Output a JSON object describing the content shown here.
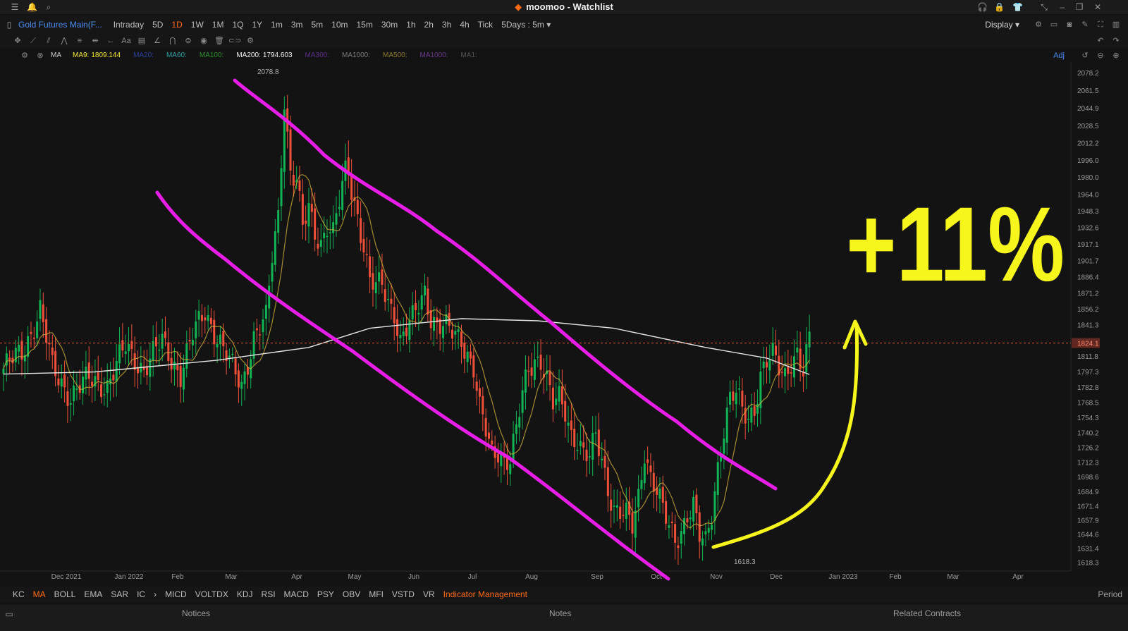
{
  "window": {
    "title": "moomoo - Watchlist"
  },
  "header": {
    "symbol": "Gold Futures Main(F...",
    "timeframes": [
      "Intraday",
      "5D",
      "1D",
      "1W",
      "1M",
      "1Q",
      "1Y",
      "1m",
      "3m",
      "5m",
      "10m",
      "15m",
      "30m",
      "1h",
      "2h",
      "3h",
      "4h",
      "Tick",
      "5Days : 5m"
    ],
    "active_timeframe_index": 2,
    "display_label": "Display"
  },
  "ma_bar": {
    "label": "MA",
    "items": [
      {
        "label": "MA9:",
        "value": "1809.144",
        "color": "#f2e630"
      },
      {
        "label": "MA20:",
        "value": "",
        "color": "#2d3f9e"
      },
      {
        "label": "MA60:",
        "value": "",
        "color": "#2aa1a1"
      },
      {
        "label": "MA100:",
        "value": "",
        "color": "#2f8f2f"
      },
      {
        "label": "MA200:",
        "value": "1794.603",
        "color": "#f0f0f0"
      },
      {
        "label": "MA300:",
        "value": "",
        "color": "#5a2d8a"
      },
      {
        "label": "MA1000:",
        "value": "",
        "color": "#7a7a7a"
      },
      {
        "label": "MA500:",
        "value": "",
        "color": "#8a7a2a"
      },
      {
        "label": "MA1000:",
        "value": "",
        "color": "#6a3a8a"
      },
      {
        "label": "MA1:",
        "value": "",
        "color": "#555555"
      }
    ],
    "adj_label": "Adj"
  },
  "colors": {
    "up": "#11b455",
    "down": "#f0503a",
    "ma9": "#d6b43b",
    "ma200": "#e6e6e6",
    "channel": "#e81ee8",
    "annotation": "#f6f51c",
    "current_price": "#f0503a",
    "background": "#131313",
    "accent": "#ff6a13"
  },
  "chart_data": {
    "type": "candlestick",
    "ylim": [
      1610,
      2088
    ],
    "y_ticks": [
      2078.2,
      2061.5,
      2044.9,
      2028.5,
      2012.2,
      1996.0,
      1980.0,
      1964.0,
      1948.3,
      1932.6,
      1917.1,
      1901.7,
      1886.4,
      1871.2,
      1856.2,
      1841.3,
      1811.8,
      1797.3,
      1782.8,
      1768.5,
      1754.3,
      1740.2,
      1726.2,
      1712.3,
      1698.6,
      1684.9,
      1671.4,
      1657.9,
      1644.6,
      1631.4,
      1618.3
    ],
    "x_labels": [
      "Dec 2021",
      "Jan 2022",
      "Feb",
      "Mar",
      "Apr",
      "May",
      "Jun",
      "Jul",
      "Aug",
      "Sep",
      "Oct",
      "Nov",
      "Dec",
      "Jan 2023",
      "Feb",
      "Mar",
      "Apr"
    ],
    "current_price": "1824.1",
    "high_label": "2078.8",
    "low_label": "1618.3",
    "ma9_last": 1809.144,
    "ma200_last": 1794.603,
    "annotation_text": "+11%",
    "keypoints": [
      [
        0,
        1800
      ],
      [
        6,
        1815
      ],
      [
        12,
        1855
      ],
      [
        16,
        1800
      ],
      [
        22,
        1775
      ],
      [
        28,
        1790
      ],
      [
        34,
        1785
      ],
      [
        40,
        1820
      ],
      [
        46,
        1800
      ],
      [
        52,
        1825
      ],
      [
        58,
        1795
      ],
      [
        62,
        1830
      ],
      [
        66,
        1855
      ],
      [
        70,
        1830
      ],
      [
        74,
        1805
      ],
      [
        78,
        1785
      ],
      [
        82,
        1830
      ],
      [
        86,
        1845
      ],
      [
        88,
        1905
      ],
      [
        90,
        1945
      ],
      [
        92,
        2055
      ],
      [
        94,
        1985
      ],
      [
        96,
        1975
      ],
      [
        98,
        1930
      ],
      [
        100,
        1950
      ],
      [
        102,
        1930
      ],
      [
        104,
        1920
      ],
      [
        106,
        1935
      ],
      [
        108,
        1925
      ],
      [
        110,
        1955
      ],
      [
        112,
        1985
      ],
      [
        113,
        1990
      ],
      [
        114,
        1970
      ],
      [
        116,
        1945
      ],
      [
        118,
        1915
      ],
      [
        120,
        1880
      ],
      [
        122,
        1875
      ],
      [
        124,
        1880
      ],
      [
        126,
        1865
      ],
      [
        128,
        1855
      ],
      [
        130,
        1825
      ],
      [
        132,
        1835
      ],
      [
        134,
        1845
      ],
      [
        136,
        1860
      ],
      [
        138,
        1875
      ],
      [
        140,
        1850
      ],
      [
        142,
        1840
      ],
      [
        146,
        1835
      ],
      [
        150,
        1830
      ],
      [
        154,
        1800
      ],
      [
        156,
        1760
      ],
      [
        158,
        1740
      ],
      [
        160,
        1720
      ],
      [
        162,
        1725
      ],
      [
        164,
        1715
      ],
      [
        166,
        1715
      ],
      [
        168,
        1740
      ],
      [
        170,
        1775
      ],
      [
        172,
        1800
      ],
      [
        174,
        1810
      ],
      [
        176,
        1810
      ],
      [
        178,
        1790
      ],
      [
        180,
        1765
      ],
      [
        182,
        1770
      ],
      [
        184,
        1760
      ],
      [
        186,
        1740
      ],
      [
        188,
        1735
      ],
      [
        190,
        1720
      ],
      [
        192,
        1715
      ],
      [
        194,
        1735
      ],
      [
        196,
        1715
      ],
      [
        198,
        1690
      ],
      [
        200,
        1670
      ],
      [
        202,
        1665
      ],
      [
        204,
        1660
      ],
      [
        206,
        1650
      ],
      [
        208,
        1680
      ],
      [
        210,
        1725
      ],
      [
        212,
        1700
      ],
      [
        214,
        1685
      ],
      [
        216,
        1665
      ],
      [
        218,
        1650
      ],
      [
        220,
        1640
      ],
      [
        222,
        1650
      ],
      [
        224,
        1665
      ],
      [
        226,
        1670
      ],
      [
        228,
        1640
      ],
      [
        230,
        1635
      ],
      [
        232,
        1665
      ],
      [
        234,
        1710
      ],
      [
        236,
        1745
      ],
      [
        238,
        1770
      ],
      [
        240,
        1775
      ],
      [
        242,
        1760
      ],
      [
        244,
        1755
      ],
      [
        246,
        1765
      ],
      [
        248,
        1795
      ],
      [
        250,
        1805
      ],
      [
        252,
        1810
      ],
      [
        254,
        1800
      ],
      [
        256,
        1795
      ],
      [
        258,
        1810
      ],
      [
        260,
        1815
      ],
      [
        262,
        1795
      ],
      [
        264,
        1825
      ]
    ]
  },
  "indicators": {
    "items": [
      "KC",
      "MA",
      "BOLL",
      "EMA",
      "SAR",
      "IC",
      "MICD",
      "VOLTDX",
      "KDJ",
      "RSI",
      "MACD",
      "PSY",
      "OBV",
      "MFI",
      "VSTD",
      "VR",
      "Indicator Management"
    ],
    "active_index": 1,
    "period_label": "Period"
  },
  "bottom": {
    "tabs": [
      "Notices",
      "Notes",
      "Related Contracts"
    ]
  }
}
